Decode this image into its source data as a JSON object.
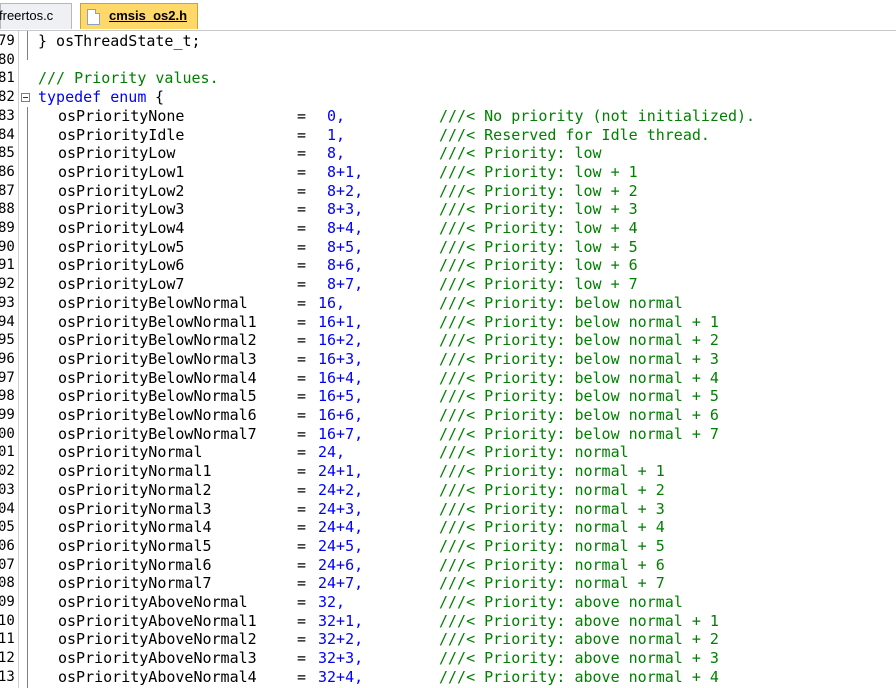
{
  "tabs": [
    {
      "label": "freertos.c",
      "active": false
    },
    {
      "label": "cmsis_os2.h",
      "active": true
    }
  ],
  "colors": {
    "keyword": "#0000ff",
    "number": "#0000ff",
    "comment": "#008000",
    "text": "#000000",
    "active_tab": "#ffd86a"
  },
  "lines": [
    {
      "ln": "79",
      "text": "} osThreadState_t;"
    },
    {
      "ln": "80",
      "text": ""
    },
    {
      "ln": "81",
      "comment": "/// Priority values."
    },
    {
      "ln": "82",
      "kw": "typedef enum",
      "text": " {"
    },
    {
      "ln": "83",
      "ident": "osPriorityNone",
      "eq": "=",
      "num": " 0,",
      "comment": "///< No priority (not initialized)."
    },
    {
      "ln": "84",
      "ident": "osPriorityIdle",
      "eq": "=",
      "num": " 1,",
      "comment": "///< Reserved for Idle thread."
    },
    {
      "ln": "85",
      "ident": "osPriorityLow",
      "eq": "=",
      "num": " 8,",
      "comment": "///< Priority: low"
    },
    {
      "ln": "86",
      "ident": "osPriorityLow1",
      "eq": "=",
      "num": " 8+1,",
      "comment": "///< Priority: low + 1"
    },
    {
      "ln": "87",
      "ident": "osPriorityLow2",
      "eq": "=",
      "num": " 8+2,",
      "comment": "///< Priority: low + 2"
    },
    {
      "ln": "88",
      "ident": "osPriorityLow3",
      "eq": "=",
      "num": " 8+3,",
      "comment": "///< Priority: low + 3"
    },
    {
      "ln": "89",
      "ident": "osPriorityLow4",
      "eq": "=",
      "num": " 8+4,",
      "comment": "///< Priority: low + 4"
    },
    {
      "ln": "90",
      "ident": "osPriorityLow5",
      "eq": "=",
      "num": " 8+5,",
      "comment": "///< Priority: low + 5"
    },
    {
      "ln": "91",
      "ident": "osPriorityLow6",
      "eq": "=",
      "num": " 8+6,",
      "comment": "///< Priority: low + 6"
    },
    {
      "ln": "92",
      "ident": "osPriorityLow7",
      "eq": "=",
      "num": " 8+7,",
      "comment": "///< Priority: low + 7"
    },
    {
      "ln": "93",
      "ident": "osPriorityBelowNormal",
      "eq": "=",
      "num": "16,",
      "comment": "///< Priority: below normal"
    },
    {
      "ln": "94",
      "ident": "osPriorityBelowNormal1",
      "eq": "=",
      "num": "16+1,",
      "comment": "///< Priority: below normal + 1"
    },
    {
      "ln": "95",
      "ident": "osPriorityBelowNormal2",
      "eq": "=",
      "num": "16+2,",
      "comment": "///< Priority: below normal + 2"
    },
    {
      "ln": "96",
      "ident": "osPriorityBelowNormal3",
      "eq": "=",
      "num": "16+3,",
      "comment": "///< Priority: below normal + 3"
    },
    {
      "ln": "97",
      "ident": "osPriorityBelowNormal4",
      "eq": "=",
      "num": "16+4,",
      "comment": "///< Priority: below normal + 4"
    },
    {
      "ln": "98",
      "ident": "osPriorityBelowNormal5",
      "eq": "=",
      "num": "16+5,",
      "comment": "///< Priority: below normal + 5"
    },
    {
      "ln": "99",
      "ident": "osPriorityBelowNormal6",
      "eq": "=",
      "num": "16+6,",
      "comment": "///< Priority: below normal + 6"
    },
    {
      "ln": "00",
      "ident": "osPriorityBelowNormal7",
      "eq": "=",
      "num": "16+7,",
      "comment": "///< Priority: below normal + 7"
    },
    {
      "ln": "01",
      "ident": "osPriorityNormal",
      "eq": "=",
      "num": "24,",
      "comment": "///< Priority: normal"
    },
    {
      "ln": "02",
      "ident": "osPriorityNormal1",
      "eq": "=",
      "num": "24+1,",
      "comment": "///< Priority: normal + 1"
    },
    {
      "ln": "03",
      "ident": "osPriorityNormal2",
      "eq": "=",
      "num": "24+2,",
      "comment": "///< Priority: normal + 2"
    },
    {
      "ln": "04",
      "ident": "osPriorityNormal3",
      "eq": "=",
      "num": "24+3,",
      "comment": "///< Priority: normal + 3"
    },
    {
      "ln": "05",
      "ident": "osPriorityNormal4",
      "eq": "=",
      "num": "24+4,",
      "comment": "///< Priority: normal + 4"
    },
    {
      "ln": "06",
      "ident": "osPriorityNormal5",
      "eq": "=",
      "num": "24+5,",
      "comment": "///< Priority: normal + 5"
    },
    {
      "ln": "07",
      "ident": "osPriorityNormal6",
      "eq": "=",
      "num": "24+6,",
      "comment": "///< Priority: normal + 6"
    },
    {
      "ln": "08",
      "ident": "osPriorityNormal7",
      "eq": "=",
      "num": "24+7,",
      "comment": "///< Priority: normal + 7"
    },
    {
      "ln": "09",
      "ident": "osPriorityAboveNormal",
      "eq": "=",
      "num": "32,",
      "comment": "///< Priority: above normal"
    },
    {
      "ln": "10",
      "ident": "osPriorityAboveNormal1",
      "eq": "=",
      "num": "32+1,",
      "comment": "///< Priority: above normal + 1"
    },
    {
      "ln": "11",
      "ident": "osPriorityAboveNormal2",
      "eq": "=",
      "num": "32+2,",
      "comment": "///< Priority: above normal + 2"
    },
    {
      "ln": "12",
      "ident": "osPriorityAboveNormal3",
      "eq": "=",
      "num": "32+3,",
      "comment": "///< Priority: above normal + 3"
    },
    {
      "ln": "13",
      "ident": "osPriorityAboveNormal4",
      "eq": "=",
      "num": "32+4,",
      "comment": "///< Priority: above normal + 4"
    }
  ]
}
